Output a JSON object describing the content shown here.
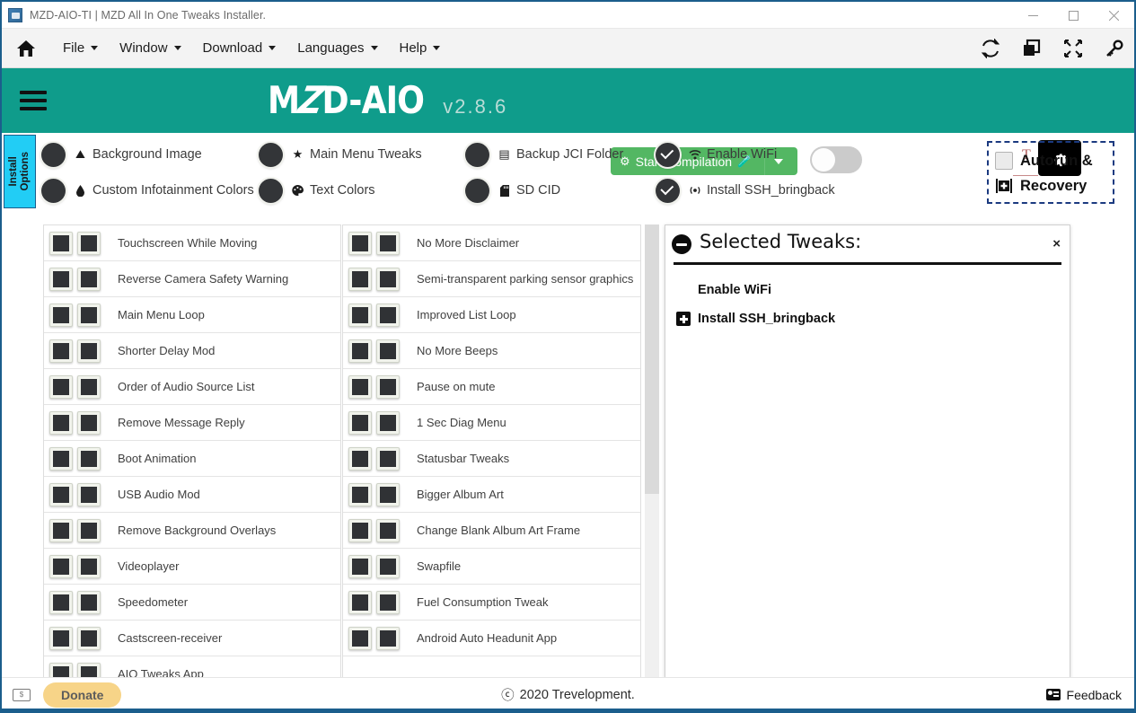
{
  "window": {
    "title": "MZD-AIO-TI | MZD All In One Tweaks Installer.",
    "app_icon": "app-icon",
    "minimize": "–",
    "maximize": "□",
    "close": "✕"
  },
  "menubar": {
    "home_icon": "home-icon",
    "items": [
      {
        "label": "File"
      },
      {
        "label": "Window"
      },
      {
        "label": "Download"
      },
      {
        "label": "Languages"
      },
      {
        "label": "Help"
      }
    ],
    "tools": [
      {
        "name": "refresh-icon"
      },
      {
        "name": "windows-icon"
      },
      {
        "name": "fullscreen-icon"
      },
      {
        "name": "key-icon"
      }
    ]
  },
  "header": {
    "menu_icon": "hamburger-icon",
    "logo_part1": "M",
    "logo_z": "Z",
    "logo_part2": "D-AIO",
    "version": "v2.8.6",
    "start_button": "Start Compilation",
    "start_icon": "atom-icon",
    "flask_icon": "flask-icon",
    "toggle_state": "off",
    "t_mark": "T",
    "gear_icon": "gear-icon",
    "accent_color": "#0f9c8b",
    "start_button_color": "#53b763"
  },
  "install_tab": {
    "line1": "Install",
    "line2": "Options",
    "color": "#22cdf5"
  },
  "options": [
    {
      "label": "Background Image",
      "icon": "image-icon",
      "icon_glyph": "⛰",
      "checked": false
    },
    {
      "label": "Custom Infotainment Colors",
      "icon": "droplet-icon",
      "icon_glyph": "▙",
      "checked": false
    },
    {
      "label": "Main Menu Tweaks",
      "icon": "star-icon",
      "icon_glyph": "★",
      "checked": false
    },
    {
      "label": "Text Colors",
      "icon": "palette-icon",
      "icon_glyph": "◕",
      "checked": false
    },
    {
      "label": "Backup JCI Folder",
      "icon": "save-icon",
      "icon_glyph": "▤",
      "checked": false
    },
    {
      "label": "SD CID",
      "icon": "sdcard-icon",
      "icon_glyph": "▮",
      "checked": false
    },
    {
      "label": "Enable WiFi",
      "icon": "wifi-icon",
      "icon_glyph": "◔",
      "checked": true
    },
    {
      "label": "Install SSH_bringback",
      "icon": "broadcast-icon",
      "icon_glyph": "◎",
      "checked": true
    }
  ],
  "autorun": {
    "line1": "Autorun &",
    "line2": "Recovery",
    "checkbox_name": "autorun-checkbox",
    "checked": false,
    "icon": "first-aid-kit-icon",
    "border_color": "#1b3a80"
  },
  "tweaks_left": [
    "Touchscreen While Moving",
    "Reverse Camera Safety Warning",
    "Main Menu Loop",
    "Shorter Delay Mod",
    "Order of Audio Source List",
    "Remove Message Reply",
    "Boot Animation",
    "USB Audio Mod",
    "Remove Background Overlays",
    "Videoplayer",
    "Speedometer",
    "Castscreen-receiver",
    "AIO Tweaks App"
  ],
  "tweaks_right": [
    "No More Disclaimer",
    "Semi-transparent parking sensor graphics",
    "Improved List Loop",
    "No More Beeps",
    "Pause on mute",
    "1 Sec Diag Menu",
    "Statusbar Tweaks",
    "Bigger Album Art",
    "Change Blank Album Art Frame",
    "Swapfile",
    "Fuel Consumption Tweak",
    "Android Auto Headunit App"
  ],
  "panel": {
    "title": "Selected Tweaks:",
    "minimize_icon": "minimize-icon",
    "close_icon": "close-icon",
    "close_label": "×",
    "items": [
      {
        "label": "Enable WiFi",
        "has_icon": false
      },
      {
        "label": "Install SSH_bringback",
        "has_icon": true
      }
    ]
  },
  "footer": {
    "money_icon": "money-icon",
    "money_glyph": "Ⓖ",
    "donate": "Donate",
    "copyright_symbol": "ⓒ",
    "copyright": "2020 Trevelopment.",
    "feedback": "Feedback",
    "feedback_icon": "feedback-icon"
  }
}
